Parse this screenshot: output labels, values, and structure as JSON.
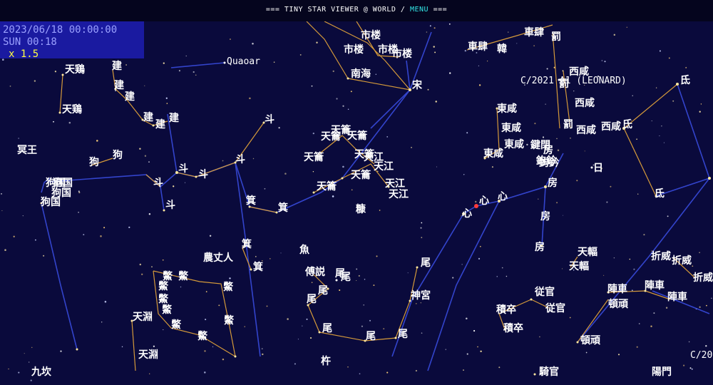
{
  "header": {
    "prefix": "=== TINY STAR VIEWER @ WORLD / ",
    "menu_label": "MENU",
    "suffix": " ==="
  },
  "info": {
    "date": "2023/06/18 00:00:00",
    "sidereal": "SUN 00:18",
    "zoom": "x 1.5"
  },
  "objects": {
    "quaoar": "Quaoar",
    "comet_leonard": "C/2021 A1 (LEONARD)",
    "comet_edge": "C/20",
    "sun": "日"
  },
  "colors": {
    "sky": "#0a0a3c",
    "line_asterism": "#d59a3a",
    "line_constellation": "#3344cc",
    "label": "#ffffff",
    "planet": "#ffffff",
    "menu": "#33e6e6",
    "info_bg": "#1a1aa0"
  },
  "star_labels": {
    "tianji_1": "天鶏",
    "tianji_2": "天鶏",
    "jian_1": "建",
    "jian_2": "建",
    "jian_3": "建",
    "jian_4": "建",
    "jian_5": "建",
    "jian_6": "建",
    "mingwang": "冥王",
    "gou_1": "狗",
    "gou_2": "狗",
    "gouguo_1": "狗国",
    "gouguo_2": "狗国",
    "gouguo_3": "狗国",
    "gouguo_4": "狗国",
    "dou_1": "斗",
    "dou_2": "斗",
    "dou_3": "斗",
    "dou_4": "斗",
    "dou_5": "斗",
    "dou_6": "斗",
    "shilou_1": "市楼",
    "shilou_2": "市楼",
    "shilou_3": "市楼",
    "shilou_4": "市楼",
    "nanhai": "南海",
    "song": "宋",
    "tianyue_1": "天籥",
    "tianyue_2": "天籥",
    "tianyue_3": "天籥",
    "tianyue_4": "天籥",
    "tianyue_5": "天籥",
    "tianyue_6": "天籥",
    "tianyue_7": "天籥",
    "tianjiang_1": "天江",
    "tianjiang_2": "天江",
    "tianjiang_3": "天江",
    "tianjiang_4": "天江",
    "ji_1": "箕",
    "ji_2": "箕",
    "ji_3": "箕",
    "ji_4": "箕",
    "kang": "糠",
    "nongzhangren": "農丈人",
    "yu": "魚",
    "chuanshuo": "傅説",
    "wei_1": "尾",
    "wei_2": "尾",
    "wei_3": "尾",
    "wei_4": "尾",
    "wei_5": "尾",
    "wei_6": "尾",
    "wei_7": "尾",
    "wei_8": "尾",
    "shengong": "神宮",
    "tianyuan_1": "天淵",
    "tianyuan_2": "天淵",
    "jiukan": "九坎",
    "chu": "杵",
    "bie_1": "鱉",
    "bie_2": "鱉",
    "bie_3": "鱉",
    "bie_4": "鱉",
    "bie_5": "鱉",
    "bie_6": "鱉",
    "bie_7": "鱉",
    "bie_8": "鱉",
    "bie_9": "鱉",
    "xin_1": "心",
    "xin_2": "心",
    "xin_3": "心",
    "fang_1": "房",
    "fang_2": "房",
    "fang_3": "房",
    "fang_4": "房",
    "gouqian_1": "鉤鈐",
    "gouqian_2": "鉤鈐",
    "jianbi": "鍵閉",
    "dongxian_1": "東咸",
    "dongxian_2": "東咸",
    "dongxian_3": "東咸",
    "dongxian_4": "東咸",
    "xixian_1": "西咸",
    "xixian_2": "西咸",
    "xixian_3": "西咸",
    "xixian_4": "西咸",
    "fa_1": "罰",
    "fa_2": "罰",
    "fa_3": "罰",
    "chesi_1": "車肆",
    "chesi_2": "車肆",
    "han": "韓",
    "di_1": "氐",
    "di_2": "氐",
    "di_3": "氐",
    "tianfu_1": "天輻",
    "tianfu_2": "天輻",
    "congguan_1": "従官",
    "congguan_2": "従官",
    "jizu_1": "積卒",
    "jizu_2": "積卒",
    "zhenche_1": "陣車",
    "zhenche_2": "陣車",
    "zhenche_3": "陣車",
    "dunwan_1": "頓頑",
    "dunwan_2": "頓頑",
    "zhewei_1": "折威",
    "zhewei_2": "折威",
    "zhewei_3": "折威",
    "qiguan": "騎官",
    "yangmen": "陽門"
  }
}
